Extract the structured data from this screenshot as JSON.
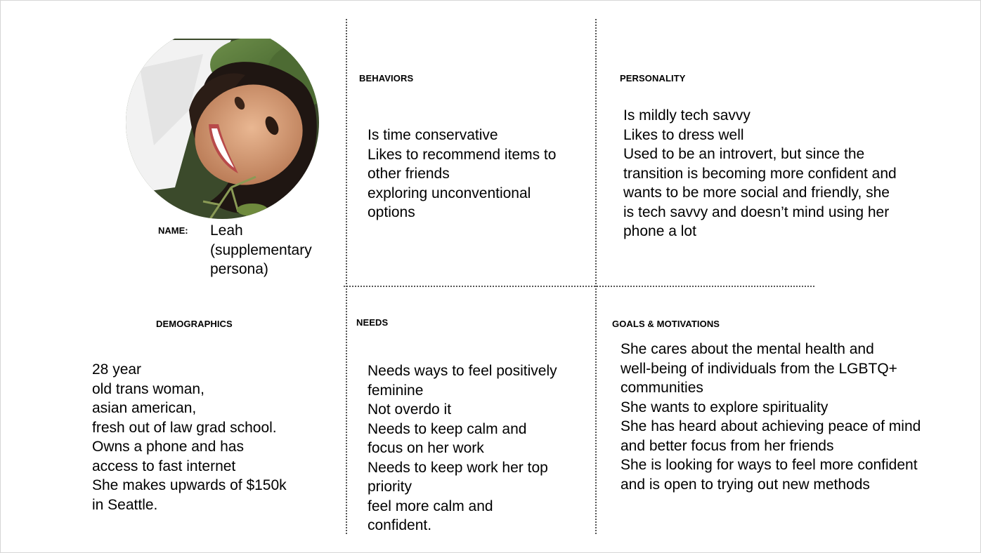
{
  "name": {
    "label": "NAME:",
    "lines": [
      "Leah",
      "(supplementary",
      "persona)"
    ]
  },
  "behaviors": {
    "heading": "BEHAVIORS",
    "lines": [
      "Is time conservative",
      "Likes to recommend items to",
      "other friends",
      "exploring unconventional",
      "options"
    ]
  },
  "personality": {
    "heading": "PERSONALITY",
    "lines": [
      "Is mildly tech savvy",
      "Likes to dress well",
      "Used to be an introvert, but since the",
      "transition is becoming more confident and",
      "wants to be more social and friendly, she",
      "is tech savvy and doesn’t mind using her",
      "phone a lot"
    ]
  },
  "demographics": {
    "heading": "DEMOGRAPHICS",
    "lines": [
      "28 year",
      "old trans woman,",
      "asian american,",
      "fresh out of law grad school.",
      "Owns a phone and has",
      "access to fast internet",
      "She makes upwards of $150k",
      "in Seattle."
    ]
  },
  "needs": {
    "heading": "NEEDS",
    "lines": [
      "Needs ways to feel positively",
      "feminine",
      "Not overdo it",
      "Needs to keep calm and",
      "focus on her work",
      "Needs to keep work her top",
      "priority",
      "feel more calm and",
      "confident."
    ]
  },
  "goals": {
    "heading": "GOALS & MOTIVATIONS",
    "lines": [
      "She cares about the mental health and",
      "well-being of individuals from the LGBTQ+",
      "communities",
      "She wants to explore spirituality",
      "She has heard about achieving peace of mind",
      "and better focus from her friends",
      "She is looking for ways to feel more confident",
      "and is open to trying out new methods"
    ]
  },
  "colors": {
    "divider": "#555555",
    "border": "#d6d6d6",
    "text": "#000000"
  }
}
